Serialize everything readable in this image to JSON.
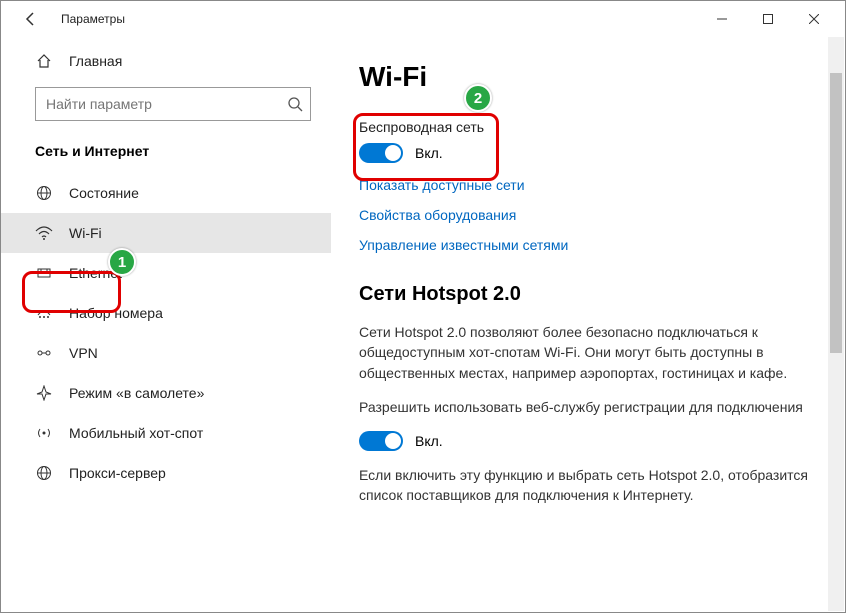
{
  "window": {
    "title": "Параметры"
  },
  "sidebar": {
    "home": "Главная",
    "search_placeholder": "Найти параметр",
    "category": "Сеть и Интернет",
    "items": [
      {
        "label": "Состояние"
      },
      {
        "label": "Wi-Fi"
      },
      {
        "label": "Ethernet"
      },
      {
        "label": "Набор номера"
      },
      {
        "label": "VPN"
      },
      {
        "label": "Режим «в самолете»"
      },
      {
        "label": "Мобильный хот-спот"
      },
      {
        "label": "Прокси-сервер"
      }
    ]
  },
  "main": {
    "title": "Wi-Fi",
    "wireless_label": "Беспроводная сеть",
    "toggle1_state": "Вкл.",
    "links": {
      "available": "Показать доступные сети",
      "hardware": "Свойства оборудования",
      "known": "Управление известными сетями"
    },
    "hotspot": {
      "heading": "Сети Hotspot 2.0",
      "desc": "Сети Hotspot 2.0 позволяют более безопасно подключаться к общедоступным хот-спотам Wi-Fi. Они могут быть доступны в общественных местах, например аэропортах, гостиницах и кафе.",
      "allow": "Разрешить использовать веб-службу регистрации для подключения",
      "toggle2_state": "Вкл.",
      "note": "Если включить эту функцию и выбрать сеть Hotspot 2.0, отобразится список поставщиков для подключения к Интернету."
    }
  },
  "annotations": {
    "b1": "1",
    "b2": "2"
  }
}
